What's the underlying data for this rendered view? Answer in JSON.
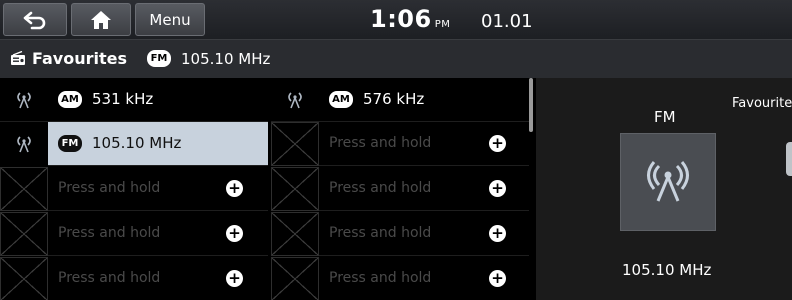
{
  "topbar": {
    "menu_label": "Menu",
    "time": "1:06",
    "ampm": "PM",
    "date": "01.01"
  },
  "titlebar": {
    "title": "Favourites",
    "band_badge": "FM",
    "frequency": "105.10 MHz"
  },
  "presets": {
    "column1": [
      {
        "band": "AM",
        "label": "531 kHz"
      },
      {
        "band": "FM",
        "label": "105.10 MHz"
      },
      {
        "placeholder": "Press and hold"
      },
      {
        "placeholder": "Press and hold"
      },
      {
        "placeholder": "Press and hold"
      }
    ],
    "column2": [
      {
        "band": "AM",
        "label": "576 kHz"
      },
      {
        "placeholder": "Press and hold"
      },
      {
        "placeholder": "Press and hold"
      },
      {
        "placeholder": "Press and hold"
      },
      {
        "placeholder": "Press and hold"
      }
    ]
  },
  "now_playing": {
    "band": "FM",
    "favourites_label": "Favourite",
    "frequency": "105.10 MHz"
  },
  "colors": {
    "selected_bg": "#c8d2dd",
    "placeholder_text": "#4a4a4a",
    "accent_white": "#ffffff"
  }
}
